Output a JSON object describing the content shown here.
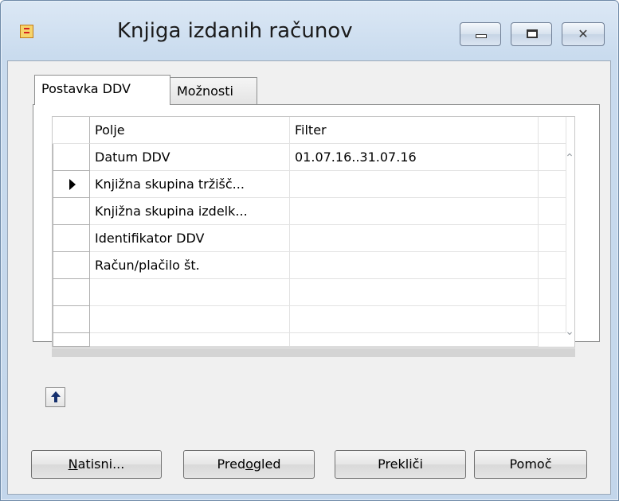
{
  "window": {
    "title": "Knjiga izdanih računov",
    "controls": {
      "close_glyph": "✕"
    }
  },
  "tabs": [
    {
      "label": "Postavka DDV",
      "active": true
    },
    {
      "label": "Možnosti",
      "active": false
    }
  ],
  "grid": {
    "columns": {
      "field": "Polje",
      "filter": "Filter"
    },
    "rows": [
      {
        "field": "Datum DDV",
        "filter": "01.07.16..31.07.16",
        "current": false
      },
      {
        "field": "Knjižna skupina tržišč...",
        "filter": "",
        "current": true
      },
      {
        "field": "Knjižna skupina izdelk...",
        "filter": "",
        "current": false
      },
      {
        "field": "Identifikator DDV",
        "filter": "",
        "current": false
      },
      {
        "field": "Račun/plačilo št.",
        "filter": "",
        "current": false
      },
      {
        "field": "",
        "filter": "",
        "current": false
      },
      {
        "field": "",
        "filter": "",
        "current": false
      },
      {
        "field": "",
        "filter": "",
        "current": false
      }
    ],
    "scroll_up_glyph": "⌃",
    "scroll_down_glyph": "⌄"
  },
  "buttons": {
    "print": {
      "mnemonic": "N",
      "rest": "atisni..."
    },
    "preview": {
      "before": "Pred",
      "mnemonic": "o",
      "after": "gled"
    },
    "cancel": "Prekliči",
    "help": "Pomoč"
  },
  "colors": {
    "accent_navy": "#16306e",
    "frame": "#c3d6eb"
  },
  "icons": {
    "app": "report-icon",
    "move_up": "arrow-up-icon"
  }
}
